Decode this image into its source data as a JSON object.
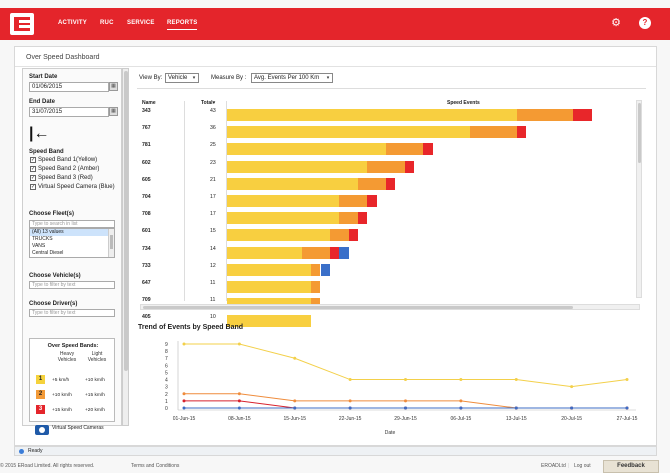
{
  "nav": {
    "items": [
      {
        "label": "ACTIVITY",
        "active": false
      },
      {
        "label": "RUC",
        "active": false
      },
      {
        "label": "SERVICE",
        "active": false
      },
      {
        "label": "REPORTS",
        "active": true
      }
    ],
    "icons": [
      "gear-icon",
      "help-icon"
    ],
    "help_glyph": "?"
  },
  "page_title": "Over Speed Dashboard",
  "sidebar": {
    "start_date_label": "Start Date",
    "start_date": "01/06/2015",
    "end_date_label": "End Date",
    "end_date": "31/07/2015",
    "speed_band_label": "Speed Band",
    "bands": [
      {
        "label": "Speed Band 1(Yellow)",
        "checked": true
      },
      {
        "label": "Speed Band 2 (Amber)",
        "checked": true
      },
      {
        "label": "Speed Band 3 (Red)",
        "checked": true
      },
      {
        "label": "Virtual Speed Camera (Blue)",
        "checked": true
      }
    ],
    "fleet_label": "Choose Fleet(s)",
    "fleet_search_placeholder": "Type to search in list",
    "fleet_options": [
      "(All) 13 values",
      "TRUCKS",
      "VANS",
      "Central Diesel"
    ],
    "vehicle_label": "Choose Vehicle(s)",
    "vehicle_placeholder": "Type to filter by text",
    "driver_label": "Choose Driver(s)",
    "driver_placeholder": "Type to filter by text",
    "legend": {
      "title": "Over Speed Bands:",
      "heavy_label": "Heavy Vehicles",
      "light_label": "Light Vehicles",
      "rows": [
        {
          "num": "1",
          "heavy": "+5 km/h",
          "light": "+10 km/h",
          "color": "#f5d23c"
        },
        {
          "num": "2",
          "heavy": "+10 km/h",
          "light": "+15 km/h",
          "color": "#f29a38"
        },
        {
          "num": "3",
          "heavy": "+15 km/h",
          "light": "+20 km/h",
          "color": "#e4252b"
        }
      ],
      "camera_label": "Virtual Speed Cameras"
    }
  },
  "controls": {
    "view_by_label": "View By:",
    "view_by_value": "Vehicle",
    "measure_by_label": "Measure By :",
    "measure_by_value": "Avg. Events Per 100 Km"
  },
  "colors": {
    "yellow": "#f8cf40",
    "amber": "#f49a33",
    "red": "#e8262a",
    "blue": "#3a6fc9",
    "brand": "#e4252b"
  },
  "chart_data": [
    {
      "type": "bar",
      "orientation": "horizontal-stacked",
      "title": "Speed Events",
      "name_header": "Name",
      "total_header": "Total",
      "categories": [
        "343",
        "767",
        "781",
        "602",
        "605",
        "704",
        "708",
        "601",
        "734",
        "733",
        "647",
        "709",
        "405"
      ],
      "totals": [
        "43",
        "36",
        "25",
        "23",
        "21",
        "17",
        "17",
        "15",
        "14",
        "12",
        "11",
        "11",
        "10"
      ],
      "series": [
        {
          "color": "#f8cf40",
          "values": [
            31,
            26,
            17,
            15,
            14,
            12,
            12,
            11,
            8,
            9,
            9,
            9,
            9
          ]
        },
        {
          "color": "#f49a33",
          "values": [
            6,
            5,
            4,
            4,
            3,
            3,
            2,
            2,
            3,
            1,
            1,
            1,
            0
          ]
        },
        {
          "color": "#e8262a",
          "values": [
            2,
            1,
            1,
            1,
            1,
            1,
            1,
            1,
            1,
            0,
            0,
            0,
            0
          ]
        },
        {
          "color": "#3a6fc9",
          "values": [
            0,
            0,
            0,
            0,
            0,
            0,
            0,
            0,
            1,
            1,
            0,
            0,
            0
          ]
        }
      ]
    },
    {
      "type": "line",
      "title": "Trend of Events by Speed Band",
      "xlabel": "Date",
      "x": [
        "01-Jun-15",
        "08-Jun-15",
        "15-Jun-15",
        "22-Jun-15",
        "29-Jun-15",
        "06-Jul-15",
        "13-Jul-15",
        "20-Jul-15",
        "27-Jul-15"
      ],
      "ylim": [
        0,
        9
      ],
      "yticks": [
        "0",
        "1",
        "2",
        "3",
        "4",
        "5",
        "6",
        "7",
        "8",
        "9"
      ],
      "series": [
        {
          "color": "#f3d04a",
          "values": [
            9,
            9,
            7,
            4,
            4,
            4,
            4,
            3,
            4
          ]
        },
        {
          "color": "#ef8c3c",
          "values": [
            2,
            2,
            1,
            1,
            1,
            1,
            0,
            0,
            0
          ]
        },
        {
          "color": "#d6222d",
          "values": [
            1,
            1,
            0,
            0,
            0,
            0,
            0,
            0,
            0
          ]
        },
        {
          "color": "#3c6cc4",
          "values": [
            0,
            0,
            0,
            0,
            0,
            0,
            0,
            0,
            0
          ]
        }
      ]
    }
  ],
  "status": {
    "text": "Ready"
  },
  "footer": {
    "copyright": "© 2015 ERoad Limited. All rights reserved.",
    "terms": "Terms and Conditions",
    "user": "EROADLtd",
    "logout": "Log out",
    "feedback": "Feedback"
  }
}
